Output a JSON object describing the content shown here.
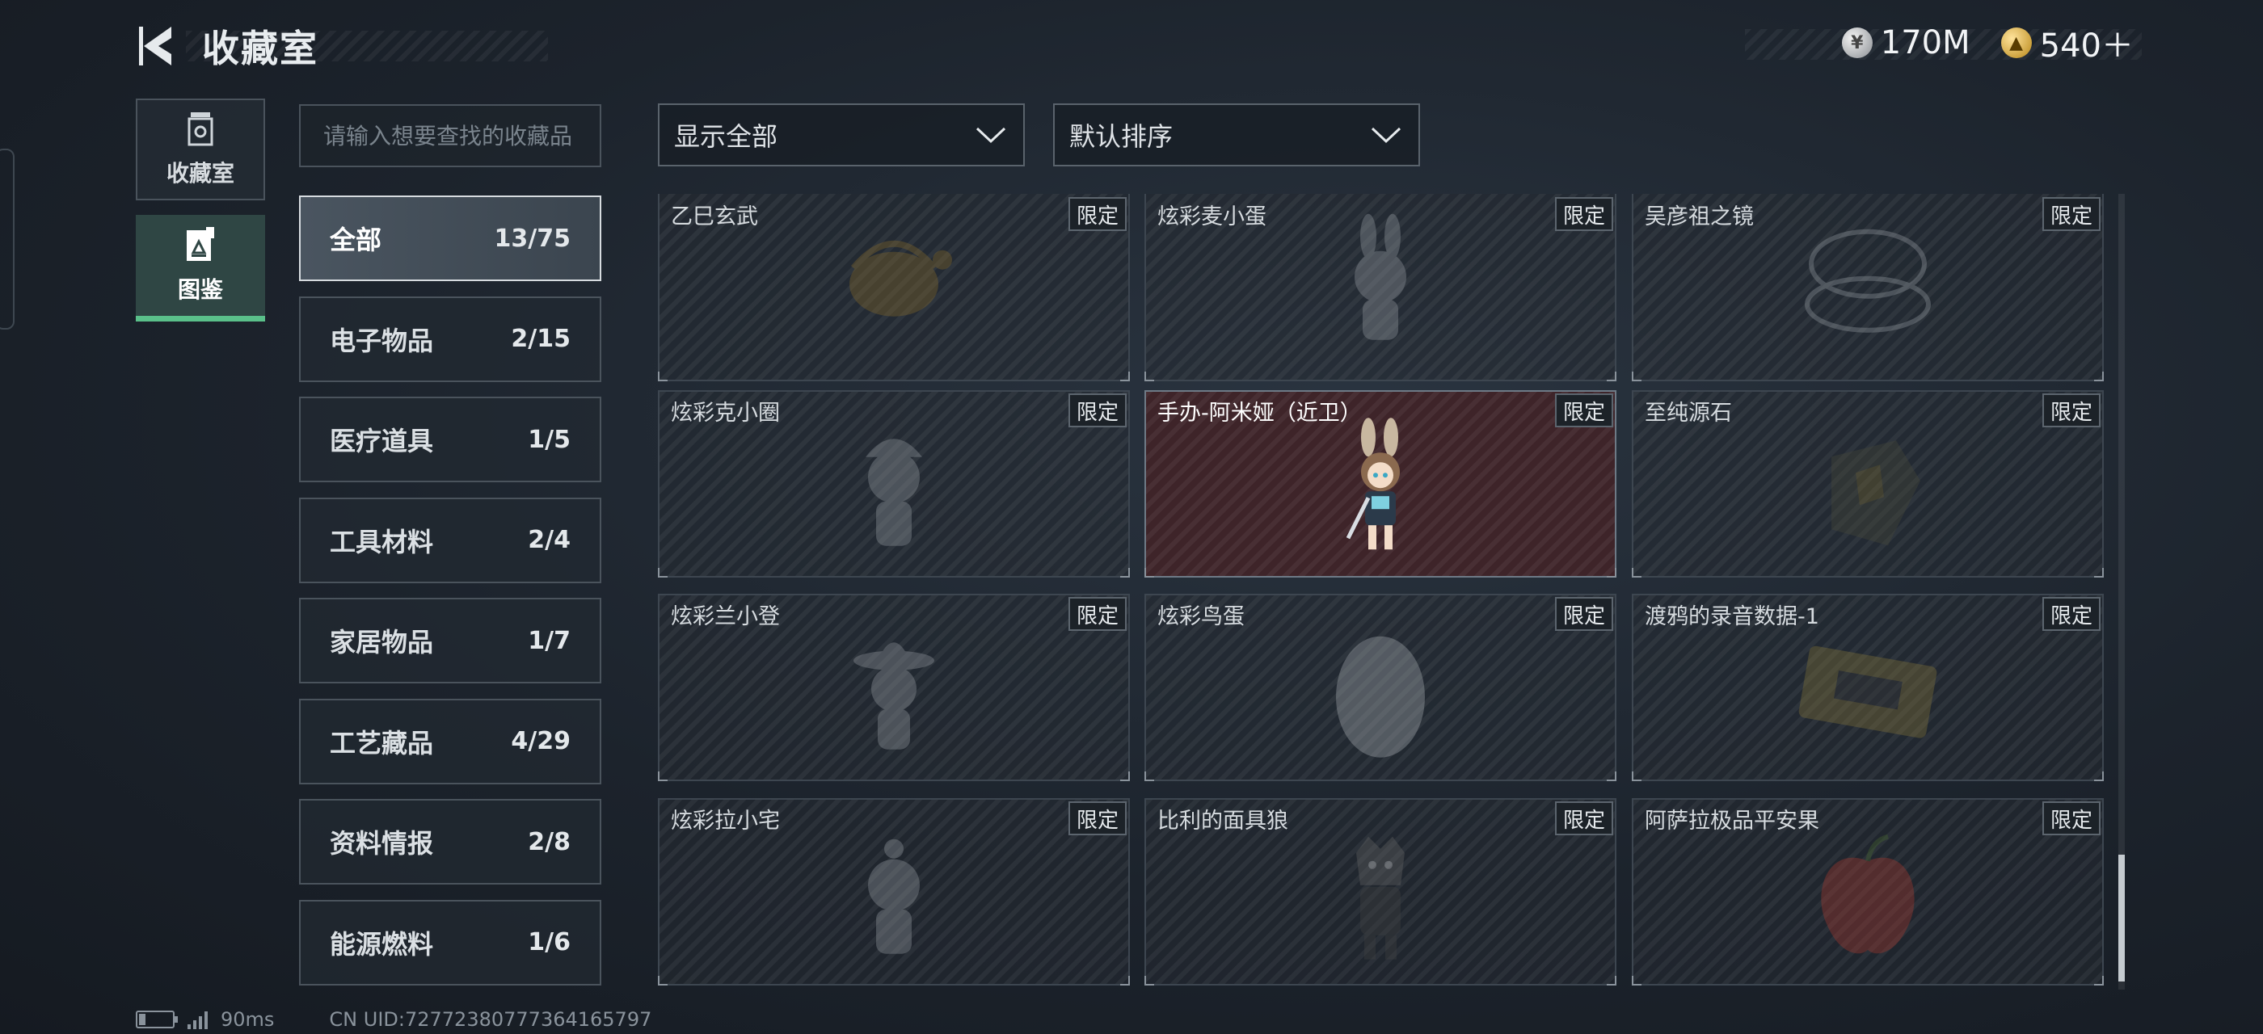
{
  "header": {
    "title": "收藏室"
  },
  "currency": [
    {
      "icon": "silver-coin-icon",
      "value": "170M"
    },
    {
      "icon": "gold-coin-icon",
      "value": "540＋"
    }
  ],
  "side_tabs": [
    {
      "label": "收藏室",
      "icon": "collection-room-icon",
      "active": false
    },
    {
      "label": "图鉴",
      "icon": "codex-icon",
      "active": true
    }
  ],
  "search": {
    "placeholder": "请输入想要查找的收藏品"
  },
  "categories": [
    {
      "name": "全部",
      "count": "13/75",
      "active": true
    },
    {
      "name": "电子物品",
      "count": "2/15",
      "active": false
    },
    {
      "name": "医疗道具",
      "count": "1/5",
      "active": false
    },
    {
      "name": "工具材料",
      "count": "2/4",
      "active": false
    },
    {
      "name": "家居物品",
      "count": "1/7",
      "active": false
    },
    {
      "name": "工艺藏品",
      "count": "4/29",
      "active": false
    },
    {
      "name": "资料情报",
      "count": "2/8",
      "active": false
    },
    {
      "name": "能源燃料",
      "count": "1/6",
      "active": false
    }
  ],
  "filters": {
    "display": "显示全部",
    "sort": "默认排序"
  },
  "badge_text": "限定",
  "items": [
    {
      "name": "乙巳玄武",
      "icon": "black-tortoise-icon",
      "highlighted": false
    },
    {
      "name": "炫彩麦小蛋",
      "icon": "bunny-figure-icon",
      "highlighted": false
    },
    {
      "name": "吴彦祖之镜",
      "icon": "compact-mirror-icon",
      "highlighted": false
    },
    {
      "name": "炫彩克小圈",
      "icon": "figure-with-cap-icon",
      "highlighted": false
    },
    {
      "name": "手办-阿米娅（近卫）",
      "icon": "amiya-figure-icon",
      "highlighted": true
    },
    {
      "name": "至纯源石",
      "icon": "originium-icon",
      "highlighted": false
    },
    {
      "name": "炫彩兰小登",
      "icon": "sombrero-figure-icon",
      "highlighted": false
    },
    {
      "name": "炫彩鸟蛋",
      "icon": "egg-icon",
      "highlighted": false
    },
    {
      "name": "渡鸦的录音数据-1",
      "icon": "recorder-device-icon",
      "highlighted": false
    },
    {
      "name": "炫彩拉小宅",
      "icon": "figure-icon",
      "highlighted": false
    },
    {
      "name": "比利的面具狼",
      "icon": "masked-wolf-icon",
      "highlighted": false
    },
    {
      "name": "阿萨拉极品平安果",
      "icon": "apple-icon",
      "highlighted": false
    }
  ],
  "scroll": {
    "thumb_start": 0.83,
    "thumb_end": 0.99
  },
  "footer": {
    "ping": "90ms",
    "uid": "CN UID:7277238077736416579​7",
    "battery_level": 0.2
  }
}
